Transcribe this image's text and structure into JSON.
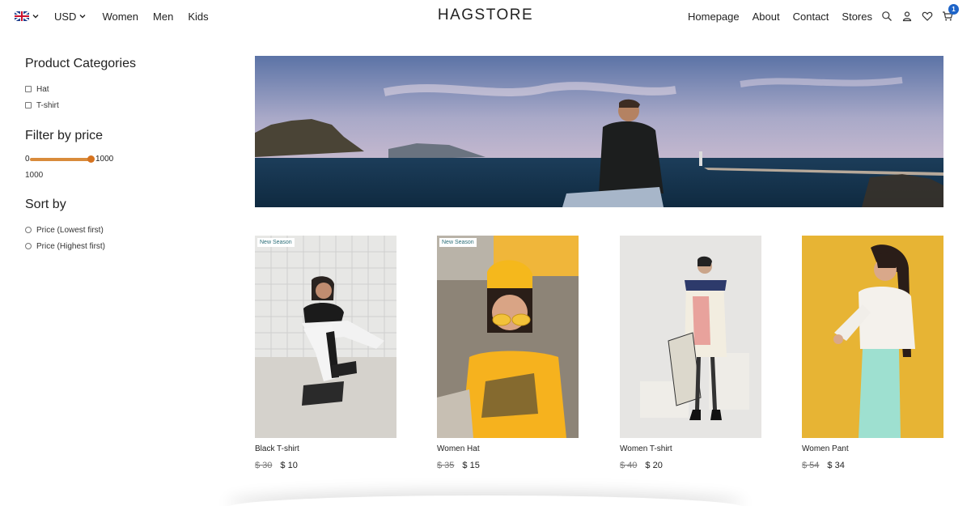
{
  "nav": {
    "language_icon": "uk-flag-icon",
    "currency": "USD",
    "left_links": [
      "Women",
      "Men",
      "Kids"
    ],
    "logo": "HAGSTORE",
    "right_links": [
      "Homepage",
      "About",
      "Contact",
      "Stores"
    ],
    "icons": [
      "search-icon",
      "user-icon",
      "heart-icon",
      "cart-icon"
    ],
    "cart_count": "1"
  },
  "sidebar": {
    "categories_title": "Product Categories",
    "categories": [
      "Hat",
      "T-shirt"
    ],
    "price_title": "Filter by price",
    "price_min": "0",
    "price_max": "1000",
    "price_value": "1000",
    "sort_title": "Sort by",
    "sort_options": [
      "Price (Lowest first)",
      "Price (Highest first)"
    ]
  },
  "products": [
    {
      "badge": "New Season",
      "name": "Black T-shirt",
      "old_price": "$ 30",
      "price": "$ 10"
    },
    {
      "badge": "New Season",
      "name": "Women Hat",
      "old_price": "$ 35",
      "price": "$ 15"
    },
    {
      "badge": "",
      "name": "Women T-shirt",
      "old_price": "$ 40",
      "price": "$ 20"
    },
    {
      "badge": "",
      "name": "Women Pant",
      "old_price": "$ 54",
      "price": "$ 34"
    }
  ],
  "colors": {
    "slider": "#d6731f",
    "badge_text": "#2c6e78",
    "cart_badge": "#1e64c8"
  }
}
